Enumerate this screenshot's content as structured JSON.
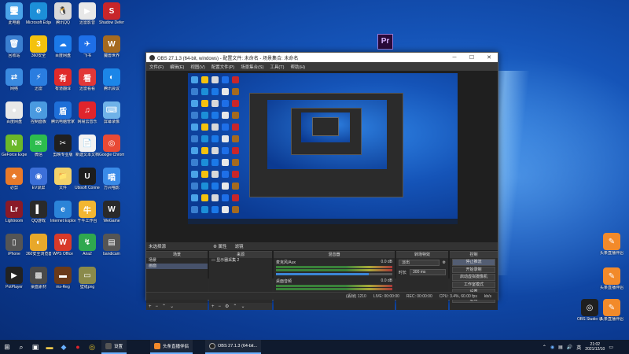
{
  "desktop": {
    "icons": [
      {
        "label": "此电脑",
        "color": "#4aa3e8",
        "glyph": "🖥"
      },
      {
        "label": "Microsoft Edge",
        "color": "#1c8fd8",
        "glyph": "e"
      },
      {
        "label": "腾讯QQ",
        "color": "#d9d9d9",
        "glyph": "🐧"
      },
      {
        "label": "迅雷影音",
        "color": "#e8e8e8",
        "glyph": "▶"
      },
      {
        "label": "Shadow Defender",
        "color": "#c8262a",
        "glyph": "S"
      },
      {
        "label": "回收站",
        "color": "#3a7fd0",
        "glyph": "🗑"
      },
      {
        "label": "360安全",
        "color": "#f4c20d",
        "glyph": "3"
      },
      {
        "label": "百度网盘",
        "color": "#1b79e8",
        "glyph": "☁"
      },
      {
        "label": "飞书",
        "color": "#1e6fe8",
        "glyph": "✈"
      },
      {
        "label": "魔兽世界",
        "color": "#a56a1f",
        "glyph": "W"
      },
      {
        "label": "网络",
        "color": "#3a8ae0",
        "glyph": "⇄"
      },
      {
        "label": "迅雷",
        "color": "#2a7de0",
        "glyph": "⚡"
      },
      {
        "label": "有道翻译",
        "color": "#e02a2a",
        "glyph": "有"
      },
      {
        "label": "迅雷看看",
        "color": "#e23838",
        "glyph": "看"
      },
      {
        "label": "腾讯会议",
        "color": "#1c86e8",
        "glyph": "◐"
      },
      {
        "label": "百度网盘",
        "color": "#e8e8e8",
        "glyph": "●"
      },
      {
        "label": "控制面板",
        "color": "#4a9ae0",
        "glyph": "⚙"
      },
      {
        "label": "腾讯电脑管家",
        "color": "#1e6fd8",
        "glyph": "盾"
      },
      {
        "label": "网易云音乐",
        "color": "#e0242c",
        "glyph": "♫"
      },
      {
        "label": "屏幕录像",
        "color": "#6fb2e8",
        "glyph": "⌨"
      },
      {
        "label": "GeForce Experience",
        "color": "#6bb82a",
        "glyph": "N"
      },
      {
        "label": "微信",
        "color": "#2dbd4e",
        "glyph": "✉"
      },
      {
        "label": "剪映专业版",
        "color": "#202020",
        "glyph": "✂"
      },
      {
        "label": "新建文本文档",
        "color": "#f2f2f2",
        "glyph": "📄"
      },
      {
        "label": "Google Chrome",
        "color": "#e84a35",
        "glyph": "◎"
      },
      {
        "label": "必剪",
        "color": "#e87a2a",
        "glyph": "♣"
      },
      {
        "label": "EV录屏",
        "color": "#3b6fd8",
        "glyph": "◉"
      },
      {
        "label": "文件",
        "color": "#f2d26a",
        "glyph": "📁"
      },
      {
        "label": "Ubisoft Connect",
        "color": "#1d1d1d",
        "glyph": "U"
      },
      {
        "label": "万兴喵影",
        "color": "#3a8be8",
        "glyph": "喵"
      },
      {
        "label": "Lightroom",
        "color": "#8a1a28",
        "glyph": "Lr"
      },
      {
        "label": "QQ游戏",
        "color": "#2a2a2a",
        "glyph": "▌"
      },
      {
        "label": "Internet Explorer",
        "color": "#2b84d8",
        "glyph": "e"
      },
      {
        "label": "千牛工作台",
        "color": "#f2b632",
        "glyph": "牛"
      },
      {
        "label": "WeGame",
        "color": "#2a2a2a",
        "glyph": "W"
      },
      {
        "label": "iPhone",
        "color": "#555",
        "glyph": "▯"
      },
      {
        "label": "360安全浏览器",
        "color": "#e8a82a",
        "glyph": "◐"
      },
      {
        "label": "WPS Office",
        "color": "#d83a2a",
        "glyph": "W"
      },
      {
        "label": "Aria2",
        "color": "#2fa84f",
        "glyph": "↯"
      },
      {
        "label": "bandicam",
        "color": "#555",
        "glyph": "▤"
      },
      {
        "label": "PotPlayer",
        "color": "#222",
        "glyph": "▶"
      },
      {
        "label": "桌面素材",
        "color": "#4a4a4a",
        "glyph": "▩"
      },
      {
        "label": "ms-Reg",
        "color": "#6a3a1a",
        "glyph": "▬"
      },
      {
        "label": "壁纸png",
        "color": "#8a8a4a",
        "glyph": "▭"
      }
    ],
    "right_icons": [
      {
        "label": "头条直播伴侣",
        "color": "#f28a2a",
        "glyph": "✎"
      },
      {
        "label": "头条直播伴侣",
        "color": "#f28a2a",
        "glyph": "✎"
      },
      {
        "label": "OBS Studio 录制和直播",
        "color": "#1f1f1f",
        "glyph": "◎"
      },
      {
        "label": "头条直播伴侣",
        "color": "#f28a2a",
        "glyph": "✎"
      }
    ],
    "pr_icon": "Pr"
  },
  "obs": {
    "title": "OBS 27.1.3 (64-bit, windows) - 配置文件: 未命名 - 场景集合: 未命名",
    "menu": [
      "文件(F)",
      "编辑(E)",
      "视图(V)",
      "配置文件(P)",
      "场景集合(S)",
      "工具(T)",
      "帮助(H)"
    ],
    "toolbar_text": "未选择源",
    "toolbar_props": "⚙ 属性",
    "toolbar_filters": "滤镜",
    "docks": {
      "scenes": {
        "title": "场景",
        "items": [
          "场景",
          "画面"
        ]
      },
      "sources": {
        "title": "来源",
        "items": [
          "显示器采集 2"
        ]
      },
      "mixer": {
        "title": "混音器",
        "tracks": [
          {
            "name": "麦克风/Aux",
            "db": "0.0 dB",
            "level": 0.8
          },
          {
            "name": "桌面音频",
            "db": "0.0 dB",
            "level": 0.9
          }
        ]
      },
      "transitions": {
        "title": "转场特效",
        "type": "淡出",
        "duration_label": "时长",
        "duration": "300 ms"
      },
      "controls": {
        "title": "控制",
        "buttons": [
          "停止推流",
          "开始录制",
          "启动虚拟摄像机",
          "工作室模式",
          "设置",
          "退出"
        ]
      }
    },
    "status": [
      "LIVE: 00:00:00",
      "REC: 00:00:00",
      "CPU: 3.4%, 60.00 fps"
    ],
    "status_badges": [
      "(丢帧) 1210",
      "kb/s"
    ]
  },
  "taskbar": {
    "apps": [
      {
        "label": "设置",
        "color": "#444"
      },
      {
        "label": "头条直播伴侣",
        "color": "#f28a2a"
      },
      {
        "label": "OBS 27.1.3 (64-bit...",
        "color": "#2a2a2a"
      }
    ],
    "time": "21:02",
    "date": "2021/12/10"
  }
}
